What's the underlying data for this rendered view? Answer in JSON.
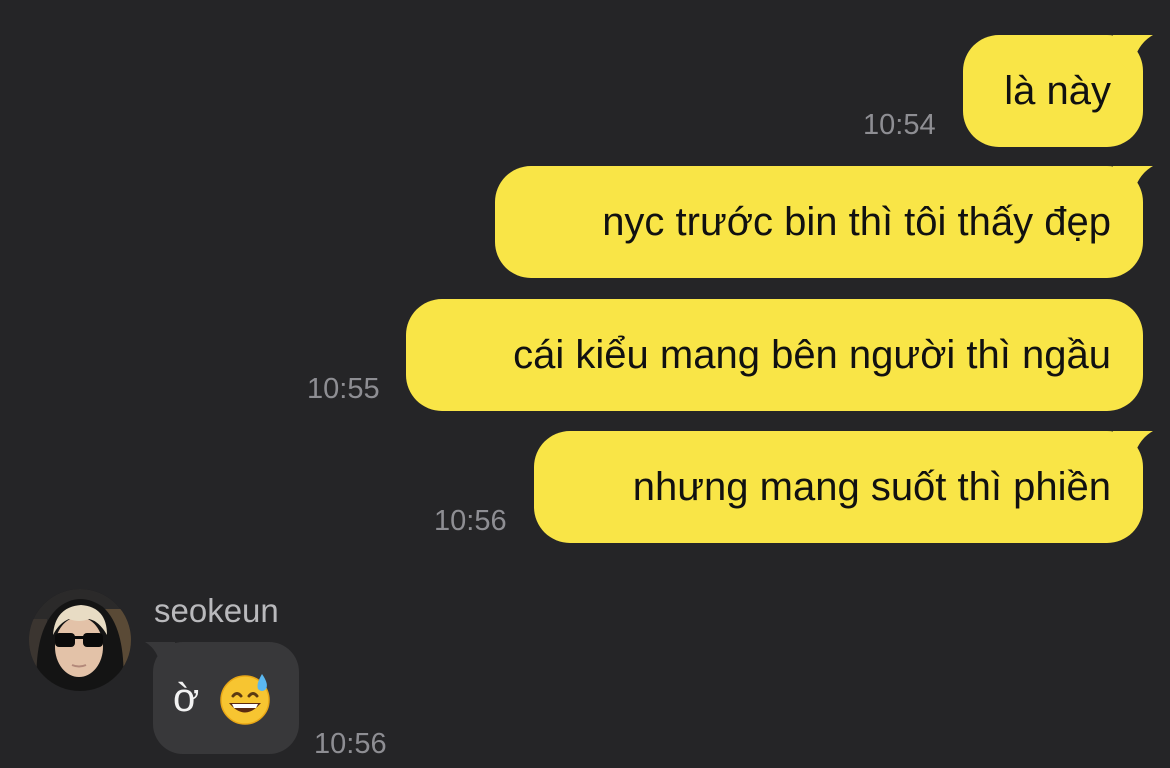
{
  "messages": [
    {
      "direction": "outgoing",
      "text": "là này",
      "time": "10:54"
    },
    {
      "direction": "outgoing",
      "text": "nyc trước bin thì tôi thấy đẹp",
      "time": ""
    },
    {
      "direction": "outgoing",
      "text": "cái kiểu mang bên người thì ngầu",
      "time": "10:55"
    },
    {
      "direction": "outgoing",
      "text": "nhưng mang suốt thì phiền",
      "time": "10:56"
    },
    {
      "direction": "incoming",
      "sender": "seokeun",
      "text": "ờ",
      "emoji": "sweat-smile-emoji",
      "time": "10:56"
    }
  ],
  "colors": {
    "background": "#252527",
    "outgoing_bubble": "#F9E547",
    "incoming_bubble": "#38383A",
    "timestamp": "#8E8E93"
  }
}
